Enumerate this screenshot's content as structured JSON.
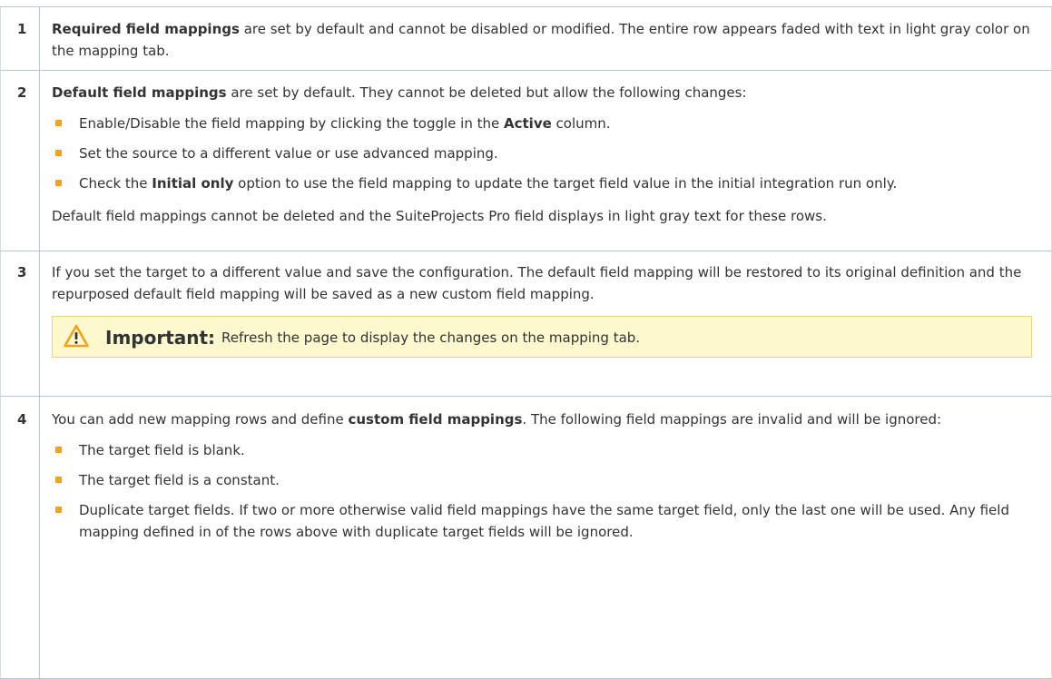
{
  "rows": [
    {
      "number": "1",
      "paragraphs": [
        {
          "bold": "Required field mappings",
          "text": " are set by default and cannot be disabled or modified. The entire row appears faded with text in light gray color on the mapping tab."
        }
      ]
    },
    {
      "number": "2",
      "intro_bold": "Default field mappings",
      "intro_text": " are set by default. They cannot be deleted but allow the following changes:",
      "bullets": [
        {
          "pre": "Enable/Disable the field mapping by clicking the toggle in the ",
          "bold": "Active",
          "post": " column."
        },
        {
          "pre": "Set the source to a different value or use advanced mapping.",
          "bold": "",
          "post": ""
        },
        {
          "pre": "Check the ",
          "bold": "Initial only",
          "post": " option to use the field mapping to update the target field value in the initial integration run only."
        }
      ],
      "outro": "Default field mappings cannot be deleted and the SuiteProjects Pro field displays in light gray text for these rows."
    },
    {
      "number": "3",
      "text": "If you set the target to a different value and save the configuration. The default field mapping will be restored to its original definition and the repurposed default field mapping will be saved as a new custom field mapping.",
      "note_title": "Important:",
      "note_text": "Refresh the page to display the changes on the mapping tab.",
      "note_icon": "warning-icon"
    },
    {
      "number": "4",
      "intro_pre": "You can add new mapping rows and define ",
      "intro_bold": "custom field mappings",
      "intro_post": ". The following field mappings are invalid and will be ignored:",
      "bullets": [
        "The target field is blank.",
        "The target field is a constant.",
        "Duplicate target fields. If two or more otherwise valid field mappings have the same target field, only the last one will be used. Any field mapping defined in of the rows above with duplicate target fields will be ignored."
      ]
    }
  ],
  "colors": {
    "bullet": "#f6a21e",
    "note_bg": "#fef8cf",
    "border": "#b9c7d3"
  }
}
